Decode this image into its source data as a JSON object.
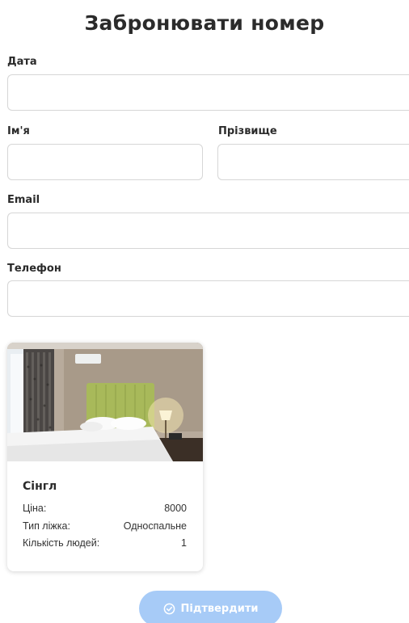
{
  "page": {
    "title": "Забронювати номер"
  },
  "form": {
    "date_label": "Дата",
    "date_value": "",
    "first_name_label": "Ім'я",
    "first_name_value": "",
    "last_name_label": "Прізвище",
    "last_name_value": "",
    "email_label": "Email",
    "email_value": "",
    "phone_label": "Телефон",
    "phone_value": ""
  },
  "room": {
    "name": "Сінгл",
    "price_label": "Ціна:",
    "price_value": "8000",
    "bed_type_label": "Тип ліжка:",
    "bed_type_value": "Односпальне",
    "people_label": "Кількість людей:",
    "people_value": "1"
  },
  "actions": {
    "confirm_label": "Підтвердити",
    "confirm_icon": "check-circle-icon",
    "confirm_color": "#a7cbf7"
  }
}
